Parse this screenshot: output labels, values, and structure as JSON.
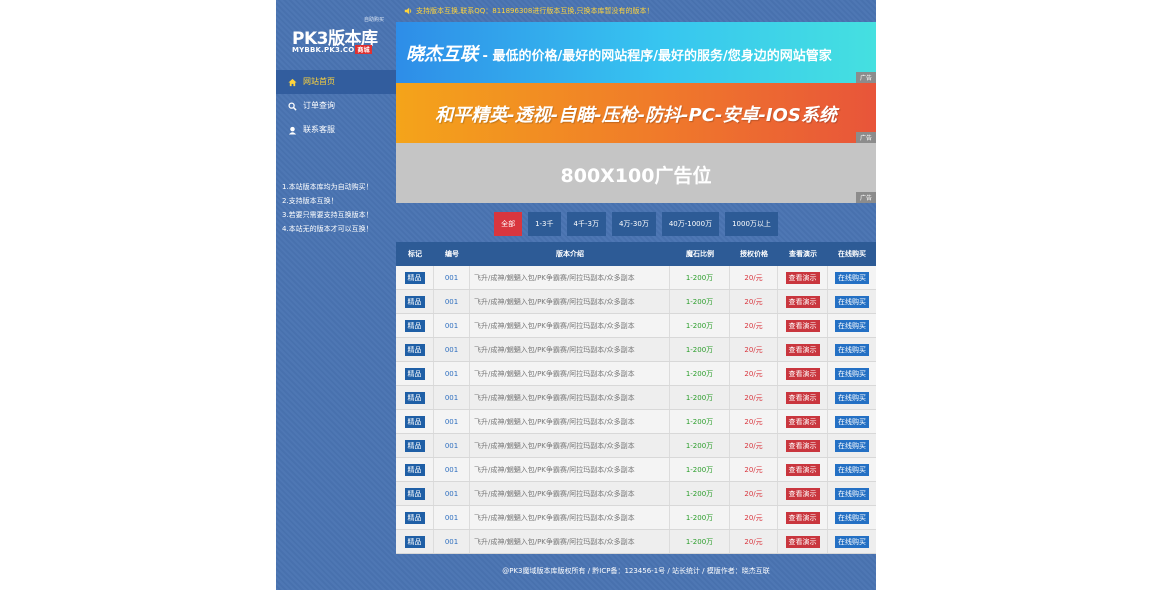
{
  "sidebar": {
    "logo_small": "自助购买",
    "logo_main": "PK3版本库",
    "logo_sub": "MYBBK.PK3.CO",
    "logo_tag": "商城",
    "nav": [
      {
        "label": "网站首页",
        "icon": "home-icon"
      },
      {
        "label": "订单查询",
        "icon": "search-icon"
      },
      {
        "label": "联系客服",
        "icon": "user-icon"
      }
    ],
    "notes": [
      "1.本站版本库均为自动购买！",
      "2.支持版本互换！",
      "3.若要只需要支持互换版本！",
      "4.本站无的版本才可以互换！"
    ]
  },
  "notice": "支持版本互换,联系QQ：811896308进行版本互换,只换本库暂没有的版本！",
  "banners": {
    "b1_brand": "晓杰互联",
    "b1_text": " - 最低的价格/最好的网站程序/最好的服务/您身边的网站管家",
    "b2_text": "和平精英-透视-自瞄-压枪-防抖-PC-安卓-IOS系统",
    "b3_text": "800X100广告位",
    "ad_label": "广告"
  },
  "filters": [
    "全部",
    "1-3千",
    "4千-3万",
    "4万-30万",
    "40万-1000万",
    "1000万以上"
  ],
  "table": {
    "headers": [
      "标记",
      "编号",
      "版本介绍",
      "魔石比例",
      "授权价格",
      "查看演示",
      "在线购买"
    ],
    "rows": [
      {
        "tag": "精品",
        "id": "001",
        "desc": "飞升/成神/魍魉入包/PK争霸赛/阿拉玛副本/众多副本",
        "ratio": "1-200万",
        "price": "20/元",
        "demo": "查看演示",
        "buy": "在线购买"
      },
      {
        "tag": "精品",
        "id": "001",
        "desc": "飞升/成神/魍魉入包/PK争霸赛/阿拉玛副本/众多副本",
        "ratio": "1-200万",
        "price": "20/元",
        "demo": "查看演示",
        "buy": "在线购买"
      },
      {
        "tag": "精品",
        "id": "001",
        "desc": "飞升/成神/魍魉入包/PK争霸赛/阿拉玛副本/众多副本",
        "ratio": "1-200万",
        "price": "20/元",
        "demo": "查看演示",
        "buy": "在线购买"
      },
      {
        "tag": "精品",
        "id": "001",
        "desc": "飞升/成神/魍魉入包/PK争霸赛/阿拉玛副本/众多副本",
        "ratio": "1-200万",
        "price": "20/元",
        "demo": "查看演示",
        "buy": "在线购买"
      },
      {
        "tag": "精品",
        "id": "001",
        "desc": "飞升/成神/魍魉入包/PK争霸赛/阿拉玛副本/众多副本",
        "ratio": "1-200万",
        "price": "20/元",
        "demo": "查看演示",
        "buy": "在线购买"
      },
      {
        "tag": "精品",
        "id": "001",
        "desc": "飞升/成神/魍魉入包/PK争霸赛/阿拉玛副本/众多副本",
        "ratio": "1-200万",
        "price": "20/元",
        "demo": "查看演示",
        "buy": "在线购买"
      },
      {
        "tag": "精品",
        "id": "001",
        "desc": "飞升/成神/魍魉入包/PK争霸赛/阿拉玛副本/众多副本",
        "ratio": "1-200万",
        "price": "20/元",
        "demo": "查看演示",
        "buy": "在线购买"
      },
      {
        "tag": "精品",
        "id": "001",
        "desc": "飞升/成神/魍魉入包/PK争霸赛/阿拉玛副本/众多副本",
        "ratio": "1-200万",
        "price": "20/元",
        "demo": "查看演示",
        "buy": "在线购买"
      },
      {
        "tag": "精品",
        "id": "001",
        "desc": "飞升/成神/魍魉入包/PK争霸赛/阿拉玛副本/众多副本",
        "ratio": "1-200万",
        "price": "20/元",
        "demo": "查看演示",
        "buy": "在线购买"
      },
      {
        "tag": "精品",
        "id": "001",
        "desc": "飞升/成神/魍魉入包/PK争霸赛/阿拉玛副本/众多副本",
        "ratio": "1-200万",
        "price": "20/元",
        "demo": "查看演示",
        "buy": "在线购买"
      },
      {
        "tag": "精品",
        "id": "001",
        "desc": "飞升/成神/魍魉入包/PK争霸赛/阿拉玛副本/众多副本",
        "ratio": "1-200万",
        "price": "20/元",
        "demo": "查看演示",
        "buy": "在线购买"
      },
      {
        "tag": "精品",
        "id": "001",
        "desc": "飞升/成神/魍魉入包/PK争霸赛/阿拉玛副本/众多副本",
        "ratio": "1-200万",
        "price": "20/元",
        "demo": "查看演示",
        "buy": "在线购买"
      }
    ]
  },
  "footer": "@PK3魔域版本库版权所有 / 黔ICP备：123456-1号 / 站长统计 / 模版作者：晓杰互联",
  "colors": {
    "page_bg": "#4a74b2",
    "accent_yellow": "#ffd43b",
    "active_filter": "#d9363e",
    "table_header": "#2d5b96"
  }
}
